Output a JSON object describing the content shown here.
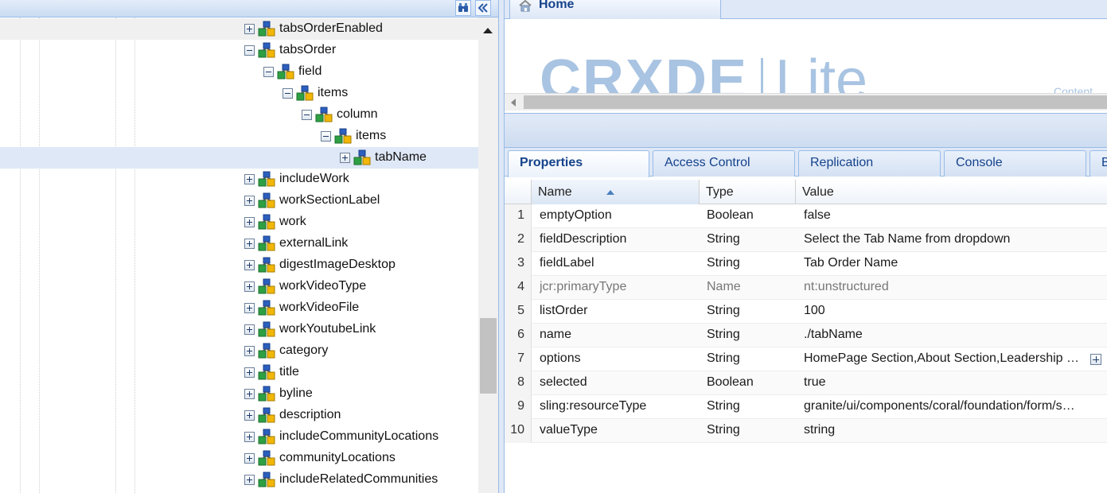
{
  "tree": {
    "nodes": [
      {
        "label": "tabsOrderEnabled",
        "expanded": false
      },
      {
        "label": "tabsOrder",
        "expanded": true
      },
      {
        "label": "field",
        "expanded": true
      },
      {
        "label": "items",
        "expanded": true
      },
      {
        "label": "column",
        "expanded": true
      },
      {
        "label": "items",
        "expanded": true
      },
      {
        "label": "tabName",
        "expanded": false,
        "selected": true
      },
      {
        "label": "includeWork",
        "expanded": false
      },
      {
        "label": "workSectionLabel",
        "expanded": false
      },
      {
        "label": "work",
        "expanded": false
      },
      {
        "label": "externalLink",
        "expanded": false
      },
      {
        "label": "digestImageDesktop",
        "expanded": false
      },
      {
        "label": "workVideoType",
        "expanded": false
      },
      {
        "label": "workVideoFile",
        "expanded": false
      },
      {
        "label": "workYoutubeLink",
        "expanded": false
      },
      {
        "label": "category",
        "expanded": false
      },
      {
        "label": "title",
        "expanded": false
      },
      {
        "label": "byline",
        "expanded": false
      },
      {
        "label": "description",
        "expanded": false
      },
      {
        "label": "includeCommunityLocations",
        "expanded": false
      },
      {
        "label": "communityLocations",
        "expanded": false
      },
      {
        "label": "includeRelatedCommunities",
        "expanded": false
      }
    ]
  },
  "home": {
    "tab_label": "Home",
    "logo_primary": "CRXDE",
    "logo_secondary": "Lite",
    "logo_subtext": "Content"
  },
  "properties": {
    "tabs": [
      "Properties",
      "Access Control",
      "Replication",
      "Console",
      "B"
    ],
    "columns": {
      "name": "Name",
      "type": "Type",
      "value": "Value"
    },
    "rows": [
      {
        "num": "1",
        "name": "emptyOption",
        "type": "Boolean",
        "value": "false"
      },
      {
        "num": "2",
        "name": "fieldDescription",
        "type": "String",
        "value": "Select the Tab Name from dropdown"
      },
      {
        "num": "3",
        "name": "fieldLabel",
        "type": "String",
        "value": "Tab Order Name"
      },
      {
        "num": "4",
        "name": "jcr:primaryType",
        "type": "Name",
        "value": "nt:unstructured"
      },
      {
        "num": "5",
        "name": "listOrder",
        "type": "String",
        "value": "100"
      },
      {
        "num": "6",
        "name": "name",
        "type": "String",
        "value": "./tabName"
      },
      {
        "num": "7",
        "name": "options",
        "type": "String",
        "value": "HomePage Section,About Section,Leadership …"
      },
      {
        "num": "8",
        "name": "selected",
        "type": "Boolean",
        "value": "true"
      },
      {
        "num": "9",
        "name": "sling:resourceType",
        "type": "String",
        "value": "granite/ui/components/coral/foundation/form/s…"
      },
      {
        "num": "10",
        "name": "valueType",
        "type": "String",
        "value": "string"
      }
    ]
  },
  "colors": {
    "accent": "#15428b",
    "header_bg": "#dfe8f6",
    "selected_row": "#dfe8f6",
    "border": "#99bbe8"
  }
}
